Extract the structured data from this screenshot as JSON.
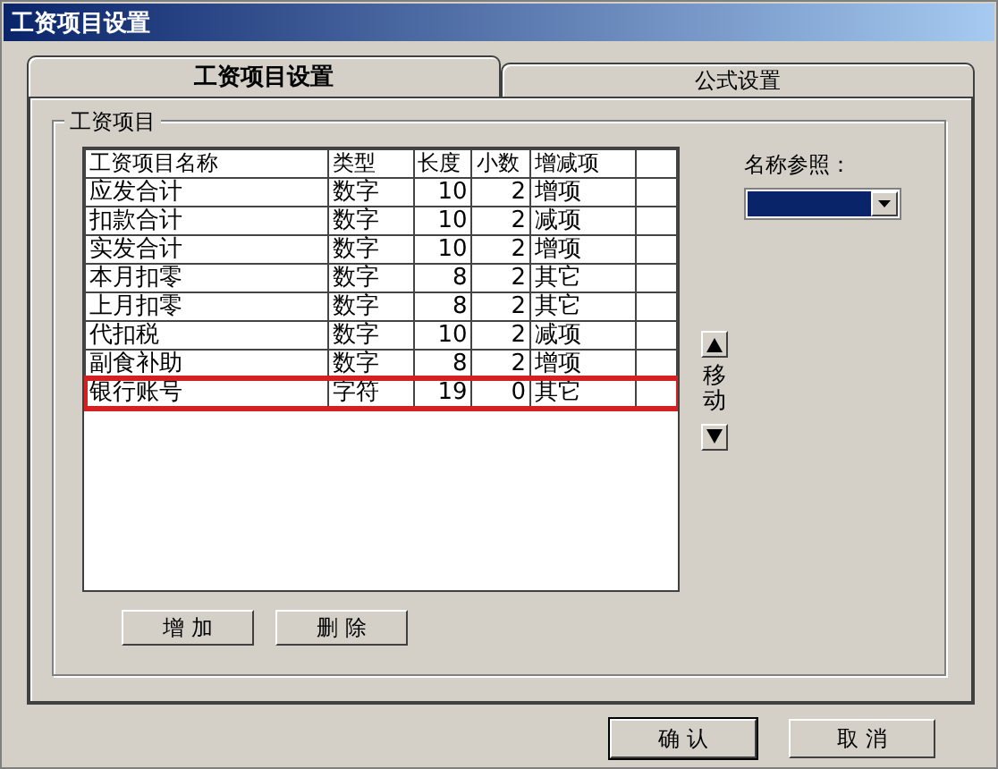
{
  "window": {
    "title": "工资项目设置"
  },
  "tabs": [
    {
      "label": "工资项目设置",
      "selected": true
    },
    {
      "label": "公式设置",
      "selected": false
    }
  ],
  "group": {
    "title": "工资项目"
  },
  "table": {
    "columns": [
      "工资项目名称",
      "类型",
      "长度",
      "小数",
      "增减项"
    ],
    "rows": [
      {
        "cells": [
          "应发合计",
          "数字",
          "10",
          "2",
          "增项"
        ],
        "highlighted": false
      },
      {
        "cells": [
          "扣款合计",
          "数字",
          "10",
          "2",
          "减项"
        ],
        "highlighted": false
      },
      {
        "cells": [
          "实发合计",
          "数字",
          "10",
          "2",
          "增项"
        ],
        "highlighted": false
      },
      {
        "cells": [
          "本月扣零",
          "数字",
          "8",
          "2",
          "其它"
        ],
        "highlighted": false
      },
      {
        "cells": [
          "上月扣零",
          "数字",
          "8",
          "2",
          "其它"
        ],
        "highlighted": false
      },
      {
        "cells": [
          "代扣税",
          "数字",
          "10",
          "2",
          "减项"
        ],
        "highlighted": false
      },
      {
        "cells": [
          "副食补助",
          "数字",
          "8",
          "2",
          "增项"
        ],
        "highlighted": false
      },
      {
        "cells": [
          "银行账号",
          "字符",
          "19",
          "0",
          "其它"
        ],
        "highlighted": true
      }
    ]
  },
  "reference": {
    "label": "名称参照："
  },
  "move": {
    "label": "移动"
  },
  "table_buttons": [
    "增 加",
    "删 除"
  ],
  "dialog_buttons": [
    "确 认",
    "取 消"
  ]
}
